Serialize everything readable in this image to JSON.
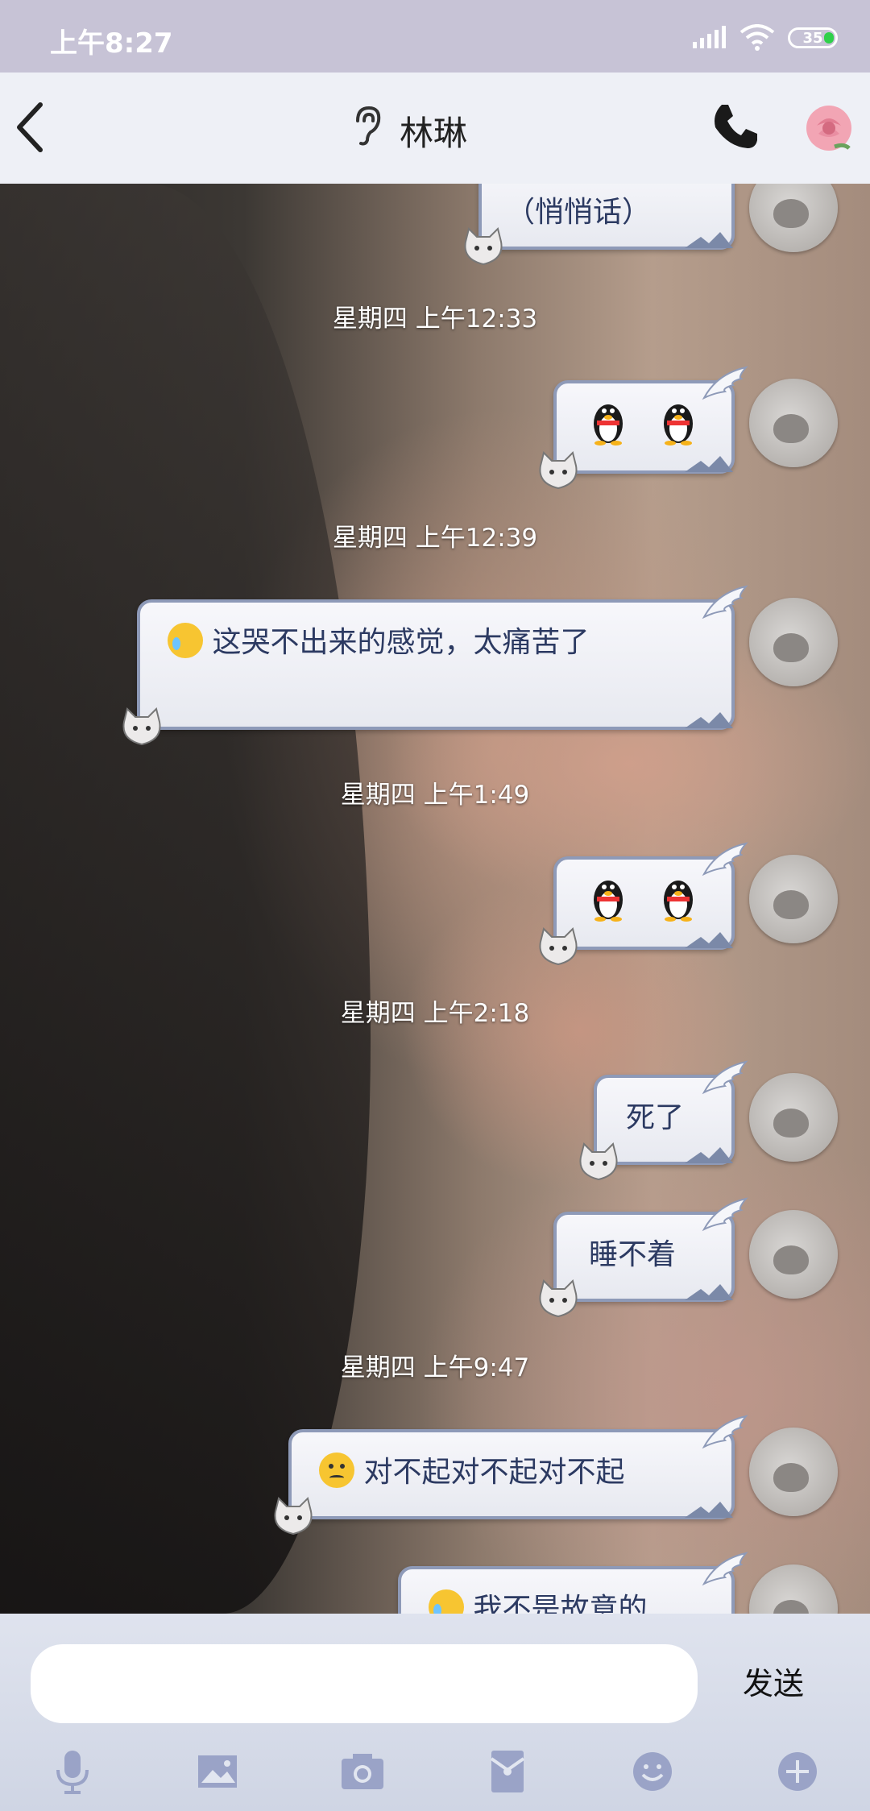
{
  "status_bar": {
    "time": "上午8:27",
    "battery": "35"
  },
  "header": {
    "contact_name": "林琳"
  },
  "messages": [
    {
      "type": "text",
      "text": "（悄悄话）"
    },
    {
      "type": "timestamp",
      "text": "星期四 上午12:33"
    },
    {
      "type": "emoji",
      "emojis": [
        "penguin-emoji",
        "penguin-emoji"
      ]
    },
    {
      "type": "timestamp",
      "text": "星期四 上午12:39"
    },
    {
      "type": "text",
      "text": "这哭不出来的感觉，太痛苦了",
      "leading_emoji": "crying-emoji"
    },
    {
      "type": "timestamp",
      "text": "星期四 上午1:49"
    },
    {
      "type": "emoji",
      "emojis": [
        "penguin-emoji",
        "penguin-emoji"
      ]
    },
    {
      "type": "timestamp",
      "text": "星期四 上午2:18"
    },
    {
      "type": "text",
      "text": "死了"
    },
    {
      "type": "text",
      "text": "睡不着"
    },
    {
      "type": "timestamp",
      "text": "星期四 上午9:47"
    },
    {
      "type": "text",
      "text": "对不起对不起对不起",
      "leading_emoji": "worried-emoji"
    },
    {
      "type": "text",
      "text": "我不是故意的",
      "leading_emoji": "crying-emoji"
    }
  ],
  "input": {
    "placeholder": "",
    "send_label": "发送"
  },
  "toolbar": [
    "microphone-icon",
    "image-icon",
    "camera-icon",
    "red-packet-icon",
    "emoji-icon",
    "plus-icon"
  ],
  "colors": {
    "bubble_border": "#8e9ab8",
    "bubble_text": "#2c3a62",
    "status_bar": "#c7c3d6",
    "toolbar_icons": "#9aa3c7"
  }
}
